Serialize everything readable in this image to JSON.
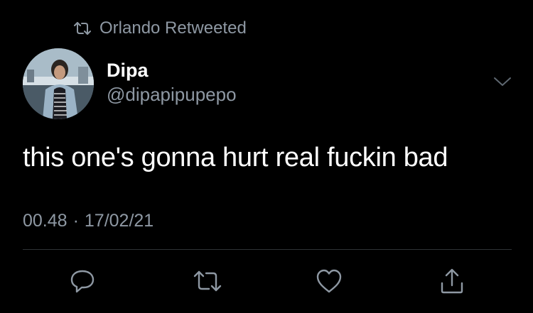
{
  "retweet_context": {
    "icon": "retweet-icon",
    "text": "Orlando Retweeted"
  },
  "author": {
    "name": "Dipa",
    "handle": "@dipapipupepo",
    "avatar": "avatar"
  },
  "tweet": {
    "text": "this one's gonna hurt real fuckin bad",
    "time": "00.48",
    "separator": "·",
    "date": "17/02/21"
  },
  "actions": [
    {
      "icon": "reply-icon"
    },
    {
      "icon": "retweet-icon"
    },
    {
      "icon": "heart-icon"
    },
    {
      "icon": "share-icon"
    }
  ],
  "colors": {
    "background": "#000000",
    "text": "#ffffff",
    "secondary": "#8e98a3",
    "divider": "#2f3336"
  }
}
